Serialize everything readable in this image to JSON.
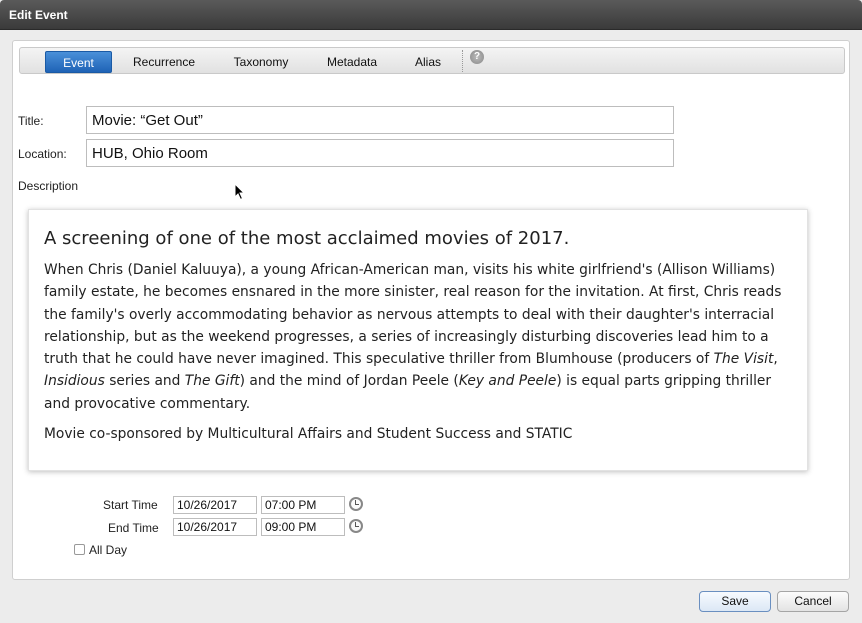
{
  "window": {
    "title": "Edit Event"
  },
  "tabs": [
    {
      "label": "Event",
      "active": true
    },
    {
      "label": "Recurrence",
      "active": false
    },
    {
      "label": "Taxonomy",
      "active": false
    },
    {
      "label": "Metadata",
      "active": false
    },
    {
      "label": "Alias",
      "active": false
    }
  ],
  "help": {
    "icon": "help-icon",
    "glyph": "?"
  },
  "form": {
    "title_label": "Title:",
    "title_value": "Movie: “Get Out”",
    "location_label": "Location:",
    "location_value": "HUB, Ohio Room",
    "description_label": "Description"
  },
  "description": {
    "heading": "A screening of one of the most acclaimed movies of 2017.",
    "paragraph1_parts": [
      {
        "text": "When Chris (Daniel Kaluuya), a young African-American man, visits his white girlfriend's (Allison Williams) family estate, he becomes ensnared in the more sinister, real reason for the invitation. At first, Chris reads the family's overly accommodating behavior as nervous attempts to deal with their daughter's interracial relationship, but as the weekend progresses, a series of increasingly disturbing discoveries lead him to a truth that he could have never imagined. This speculative thriller from Blumhouse (producers of ",
        "italic": false
      },
      {
        "text": "The Visit",
        "italic": true
      },
      {
        "text": ", ",
        "italic": false
      },
      {
        "text": "Insidious",
        "italic": true
      },
      {
        "text": " series and ",
        "italic": false
      },
      {
        "text": "The Gift",
        "italic": true
      },
      {
        "text": ") and the mind of Jordan Peele (",
        "italic": false
      },
      {
        "text": "Key and Peele",
        "italic": true
      },
      {
        "text": ") is equal parts gripping thriller and provocative commentary.",
        "italic": false
      }
    ],
    "paragraph2": "Movie co-sponsored by Multicultural Affairs and Student Success and STATIC"
  },
  "schedule": {
    "start_label": "Start Time",
    "start_date": "10/26/2017",
    "start_time": "07:00 PM",
    "end_label": "End Time",
    "end_date": "10/26/2017",
    "end_time": "09:00 PM",
    "all_day_label": "All Day",
    "all_day_checked": false,
    "clock_icon": "clock-icon"
  },
  "buttons": {
    "save": "Save",
    "cancel": "Cancel"
  },
  "colors": {
    "active_tab": "#2a72c6",
    "titlebar": "#444444"
  }
}
